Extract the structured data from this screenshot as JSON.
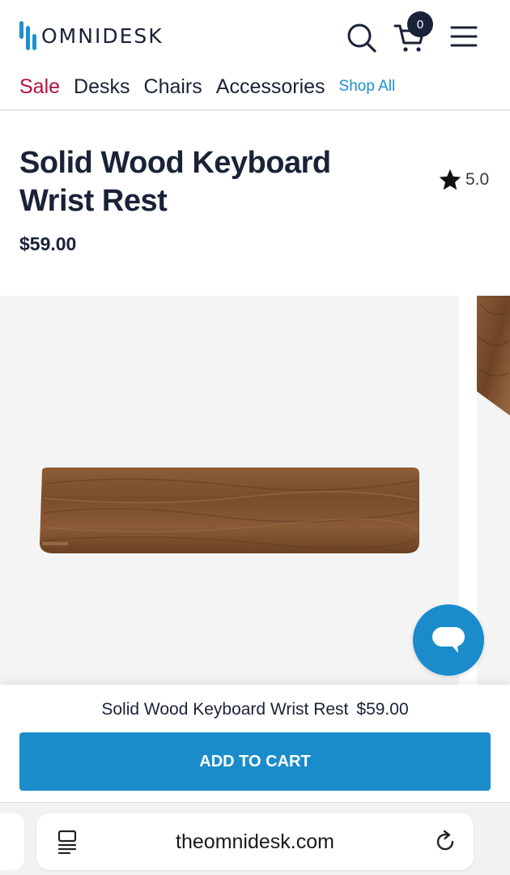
{
  "brand": {
    "name": "OMNIDESK",
    "accent": "#1e8fcf",
    "dark": "#1a2238",
    "sale_color": "#b3123c"
  },
  "header": {
    "search_icon": "search-icon",
    "cart_icon": "cart-icon",
    "cart_count": "0",
    "menu_icon": "hamburger-menu-icon"
  },
  "nav": {
    "items": [
      {
        "label": "Sale"
      },
      {
        "label": "Desks"
      },
      {
        "label": "Chairs"
      },
      {
        "label": "Accessories"
      },
      {
        "label": "Shop All"
      }
    ]
  },
  "product": {
    "title": "Solid Wood Keyboard Wrist Rest",
    "price": "$59.00",
    "rating": "5.0",
    "rating_icon": "star-icon"
  },
  "gallery": {
    "chat_icon": "chat-bubble-icon"
  },
  "sticky": {
    "name": "Solid Wood Keyboard Wrist Rest",
    "price": "$59.00",
    "button": "ADD TO CART"
  },
  "browser": {
    "url": "theomnidesk.com",
    "reader_icon": "reader-mode-icon",
    "reload_icon": "reload-icon"
  }
}
